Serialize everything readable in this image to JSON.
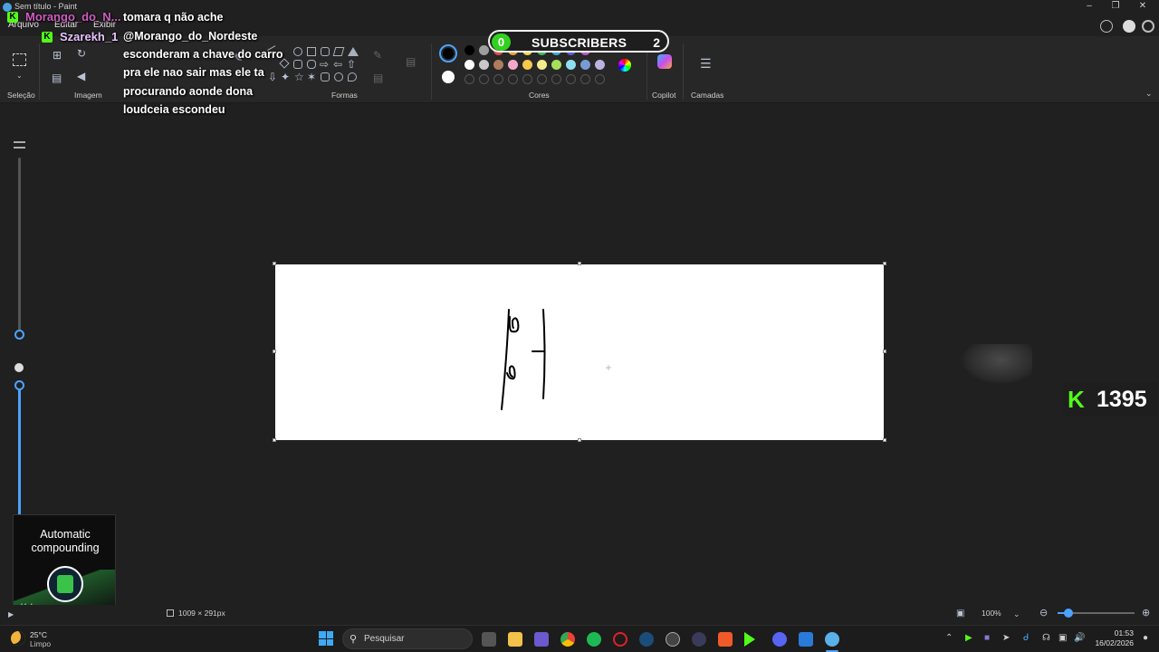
{
  "window": {
    "title": "Sem título - Paint"
  },
  "menu": {
    "items": [
      "Arquivo",
      "Editar",
      "Exibir"
    ]
  },
  "ribbon": {
    "sections": {
      "selection": "Seleção",
      "image": "Imagem",
      "shapes": "Formas",
      "colors": "Cores",
      "copilot": "Copilot",
      "layers": "Camadas"
    },
    "palette_row1": [
      "#000000",
      "#9e9e9e",
      "#e04a4a",
      "#e8a33a",
      "#f2d94a",
      "#3fbf5a",
      "#42a9e0",
      "#5a5fd6",
      "#b85cc9"
    ],
    "palette_row2": [
      "#ffffff",
      "#c8c8c8",
      "#b07c5c",
      "#f5a8c8",
      "#f7c84a",
      "#f2ec8c",
      "#a6e05a",
      "#8ee0f0",
      "#7a9ad6",
      "#b9b4e0"
    ],
    "primary_color": "#000000",
    "secondary_color": "#ffffff"
  },
  "overlay": {
    "chat": [
      {
        "name": "Morango_do_N...",
        "message": "tomara q não ache"
      },
      {
        "name": "Szarekh_1",
        "message": "@Morango_do_Nordeste"
      }
    ],
    "chat_lines": [
      "tomara q não ache",
      "@Morango_do_Nordeste",
      "esconderam a chave do carro",
      "pra ele nao sair mas ele ta",
      "procurando aonde dona",
      "loudceia escondeu"
    ],
    "subscribers": {
      "left": "0",
      "label": "SUBSCRIBERS",
      "count": "2"
    },
    "kick_counter": "1395",
    "ad": {
      "line1": "Automatic",
      "line2": "compounding",
      "brand": "Valo"
    }
  },
  "status_bar": {
    "dimensions": "1009 × 291px",
    "zoom": "100%"
  },
  "taskbar": {
    "search_placeholder": "Pesquisar",
    "weather_temp": "25°C",
    "weather_condition": "Limpo",
    "time": "01:53",
    "date": "16/02/2026"
  }
}
